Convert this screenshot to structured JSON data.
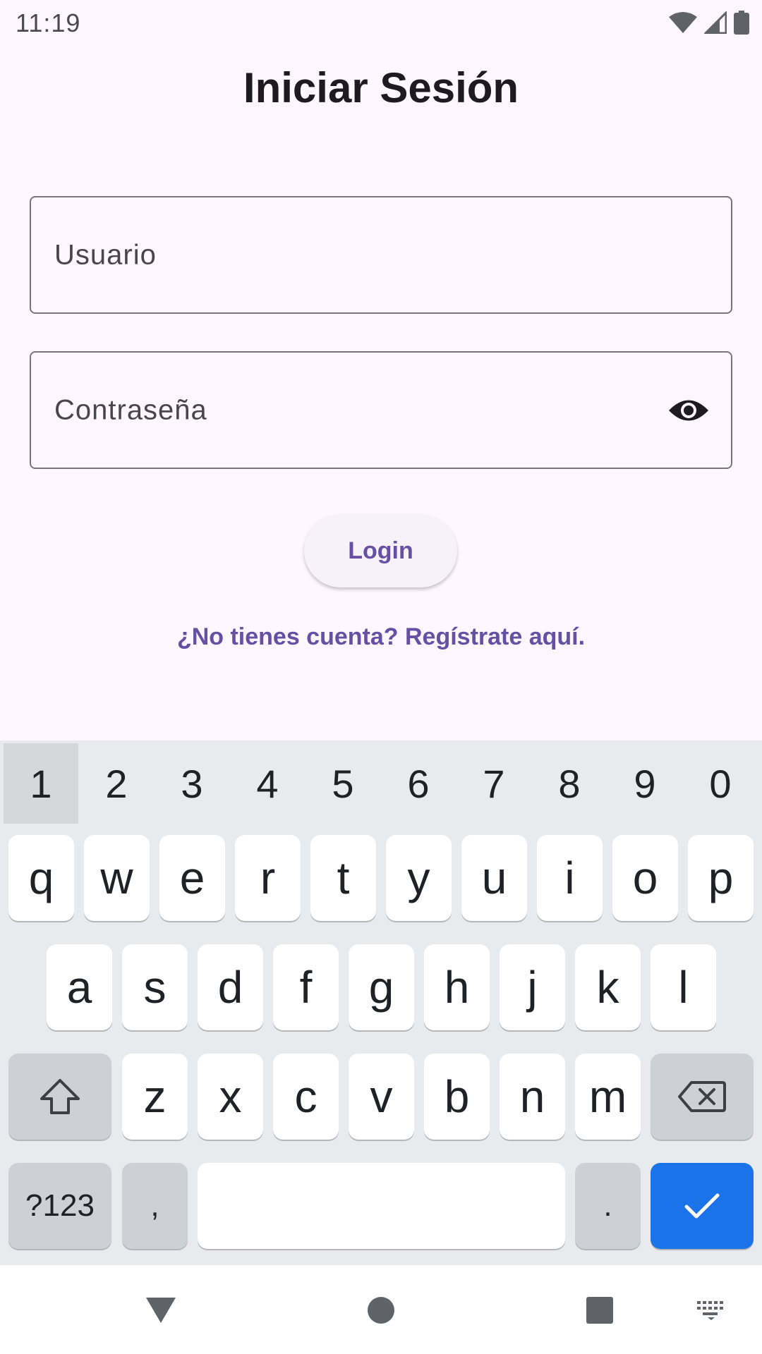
{
  "status_bar": {
    "time": "11:19"
  },
  "login": {
    "title": "Iniciar Sesión",
    "username_placeholder": "Usuario",
    "password_placeholder": "Contraseña",
    "login_label": "Login",
    "register_link": "¿No tienes cuenta? Regístrate aquí."
  },
  "keyboard": {
    "numbers": [
      "1",
      "2",
      "3",
      "4",
      "5",
      "6",
      "7",
      "8",
      "9",
      "0"
    ],
    "row1": [
      "q",
      "w",
      "e",
      "r",
      "t",
      "y",
      "u",
      "i",
      "o",
      "p"
    ],
    "row2": [
      "a",
      "s",
      "d",
      "f",
      "g",
      "h",
      "j",
      "k",
      "l"
    ],
    "row3": [
      "z",
      "x",
      "c",
      "v",
      "b",
      "n",
      "m"
    ],
    "symbols_label": "?123",
    "comma_label": ",",
    "period_label": ".",
    "enter_color": "#1a73e8"
  },
  "colors": {
    "background": "#fef7ff",
    "accent": "#6750a4",
    "outline": "#79747e"
  }
}
